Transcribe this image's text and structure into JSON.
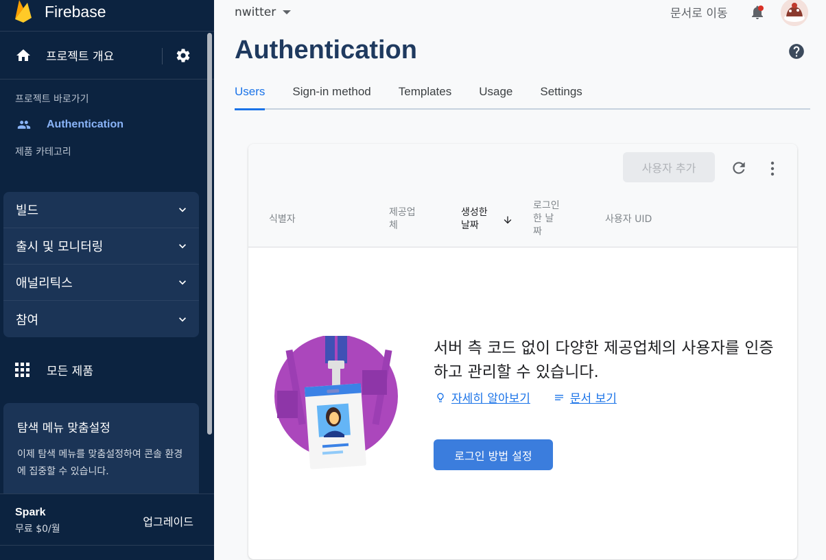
{
  "sidebar": {
    "brand": "Firebase",
    "overview_label": "프로젝트 개요",
    "shortcuts_title": "프로젝트 바로가기",
    "auth_label": "Authentication",
    "categories_title": "제품 카테고리",
    "categories": [
      {
        "label": "빌드"
      },
      {
        "label": "출시 및 모니터링"
      },
      {
        "label": "애널리틱스"
      },
      {
        "label": "참여"
      }
    ],
    "all_products": "모든 제품",
    "customize_title": "탐색 메뉴 맞춤설정",
    "customize_text": "이제 탐색 메뉴를 맞춤설정하여 콘솔 환경에 집중할 수 있습니다.",
    "plan_name": "Spark",
    "plan_price": "무료 $0/월",
    "upgrade": "업그레이드"
  },
  "header": {
    "project": "nwitter",
    "docs": "문서로 이동"
  },
  "page": {
    "title": "Authentication",
    "tabs": [
      {
        "label": "Users",
        "active": true
      },
      {
        "label": "Sign-in method"
      },
      {
        "label": "Templates"
      },
      {
        "label": "Usage"
      },
      {
        "label": "Settings"
      }
    ]
  },
  "table": {
    "add_user": "사용자 추가",
    "columns": {
      "identifier": "식별자",
      "provider": "제공업\n체",
      "created": "생성한\n날짜",
      "signed_in": "로그인\n한 날\n짜",
      "uid": "사용자 UID"
    }
  },
  "empty": {
    "message": "서버 측 코드 없이 다양한 제공업체의 사용자를 인증하고 관리할 수 있습니다.",
    "learn_more": "자세히 알아보기",
    "view_docs": "문서 보기",
    "setup_button": "로그인 방법 설정"
  },
  "colors": {
    "sidebar_bg": "#0c2340",
    "accent": "#1a73e8",
    "primary_button": "#3b7ddd"
  }
}
